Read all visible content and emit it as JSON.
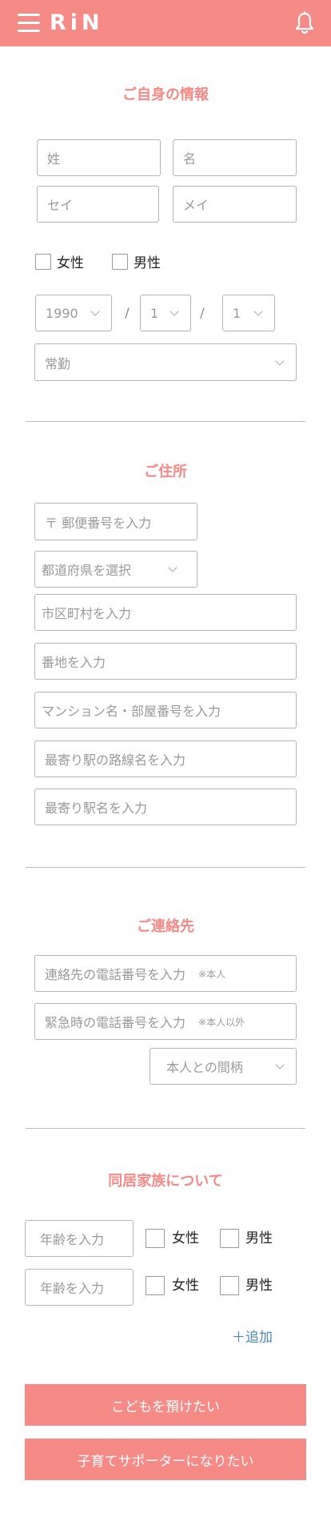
{
  "header": {
    "logo": "RiN",
    "menu_icon": "hamburger-menu-icon",
    "bell_icon": "bell-icon",
    "color": "#f68a87"
  },
  "profile": {
    "title": "ご自身の情報",
    "last_name_placeholder": "姓",
    "first_name_placeholder": "名",
    "last_kana_placeholder": "セイ",
    "first_kana_placeholder": "メイ",
    "gender_female": "女性",
    "gender_male": "男性",
    "birth_year": "1990",
    "birth_month": "1",
    "birth_day": "1",
    "separator": "/",
    "employment": "常勤"
  },
  "address": {
    "title": "ご住所",
    "postal_placeholder": "〒 郵便番号を入力",
    "prefecture_placeholder": "都道府県を選択",
    "city_placeholder": "市区町村を入力",
    "street_placeholder": "番地を入力",
    "building_placeholder": "マンション名・部屋番号を入力",
    "line_placeholder": "最寄り駅の路線名を入力",
    "station_placeholder": "最寄り駅名を入力"
  },
  "contact": {
    "title": "ご連絡先",
    "phone_placeholder": "連絡先の電話番号を入力",
    "phone_note": "※本人",
    "emergency_placeholder": "緊急時の電話番号を入力",
    "emergency_note": "※本人以外",
    "relation_placeholder": "本人との間柄"
  },
  "family": {
    "title": "同居家族について",
    "members": [
      {
        "age_placeholder": "年齢を入力",
        "female": "女性",
        "male": "男性"
      },
      {
        "age_placeholder": "年齢を入力",
        "female": "女性",
        "male": "男性"
      }
    ],
    "add_label": "＋追加"
  },
  "actions": {
    "entrust_child": "こどもを預けたい",
    "become_supporter": "子育てサポーターになりたい"
  }
}
